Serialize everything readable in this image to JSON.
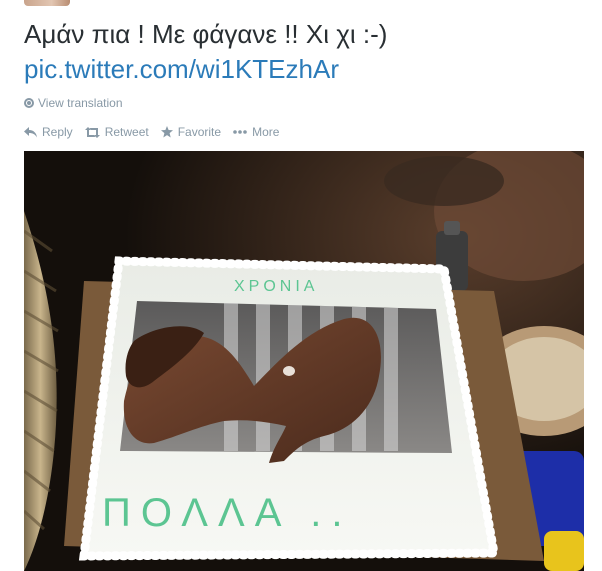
{
  "tweet": {
    "text": "Αμάν πια ! Με φάγανε !! Χι χι :-)",
    "link": "pic.twitter.com/wi1KTEzhAr"
  },
  "translation": {
    "label": "View translation",
    "icon": "globe-icon"
  },
  "actions": {
    "reply": "Reply",
    "retweet": "Retweet",
    "favorite": "Favorite",
    "more": "More"
  },
  "media": {
    "cake_text": "ΠΟΛΛΑ ..",
    "cake_top_text": "ΧΡΟΝΙΑ",
    "colors": {
      "frosting": "#f2f4f0",
      "icing_text": "#5cc592",
      "background": "#1a1510"
    }
  }
}
